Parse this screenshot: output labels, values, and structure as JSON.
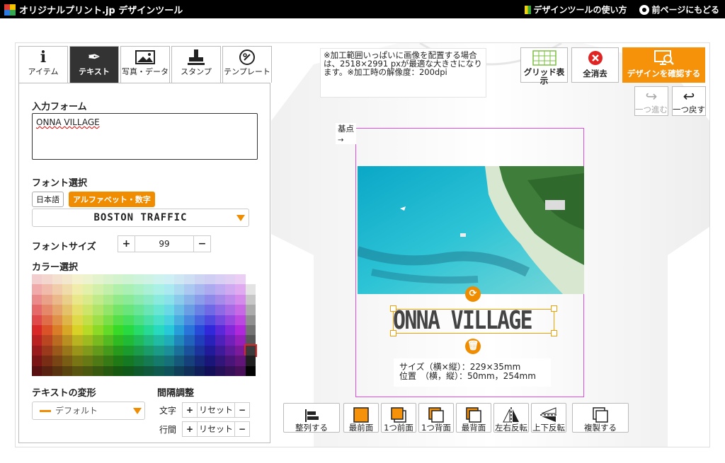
{
  "topbar": {
    "logo_text": "オリジナルプリント.jp デザインツール",
    "guide_link": "デザインツールの使い方",
    "back_link": "前ページにもどる"
  },
  "tabs": [
    {
      "label": "アイテム",
      "icon": "info-icon"
    },
    {
      "label": "テキスト",
      "icon": "pen-icon",
      "active": true
    },
    {
      "label": "写真・データ",
      "icon": "image-icon"
    },
    {
      "label": "スタンプ",
      "icon": "stamp-icon"
    },
    {
      "label": "テンプレート",
      "icon": "template-icon"
    }
  ],
  "panel": {
    "input_heading": "入力フォーム",
    "input_value": "ONNA VILLAGE",
    "font_heading": "フォント選択",
    "font_tab_ja": "日本語",
    "font_tab_alpha": "アルファベット・数字",
    "font_selected": "BOSTON TRAFFIC",
    "size_heading": "フォントサイズ",
    "size_value": "99",
    "plus": "+",
    "minus": "−",
    "color_heading": "カラー選択",
    "transform_heading": "テキストの変形",
    "transform_value": "デフォルト",
    "spacing_heading": "間隔調整",
    "char_label": "文字",
    "line_label": "行間",
    "reset_label": "リセット"
  },
  "canvas": {
    "notice": "※加工範囲いっぱいに画像を配置する場合は、2518×2991 pxが最適な大きさになります。※加工時の解像度：200dpi",
    "origin_label": "基点",
    "design_text": "ONNA VILLAGE",
    "size_info": "サイズ（横×縦）：229×35mm",
    "position_info": "位置　（横，縦）：50mm，254mm"
  },
  "right_buttons": {
    "grid": "グリッド表示",
    "clear": "全消去",
    "confirm": "デザインを確認する",
    "redo": "一つ進む",
    "undo": "一つ戻す"
  },
  "bottom_buttons": [
    {
      "label": "整列する",
      "icon": "align-icon"
    },
    {
      "label": "最前面",
      "icon": "bring-front-icon"
    },
    {
      "label": "1つ前面",
      "icon": "bring-forward-icon"
    },
    {
      "label": "1つ背面",
      "icon": "send-backward-icon"
    },
    {
      "label": "最背面",
      "icon": "send-back-icon"
    },
    {
      "label": "左右反転",
      "icon": "flip-horizontal-icon"
    },
    {
      "label": "上下反転",
      "icon": "flip-vertical-icon"
    },
    {
      "label": "複製する",
      "icon": "duplicate-icon"
    }
  ],
  "colors": {
    "accent": "#f08c00",
    "print_area": "#e14ee0",
    "selection": "#f0a000"
  }
}
